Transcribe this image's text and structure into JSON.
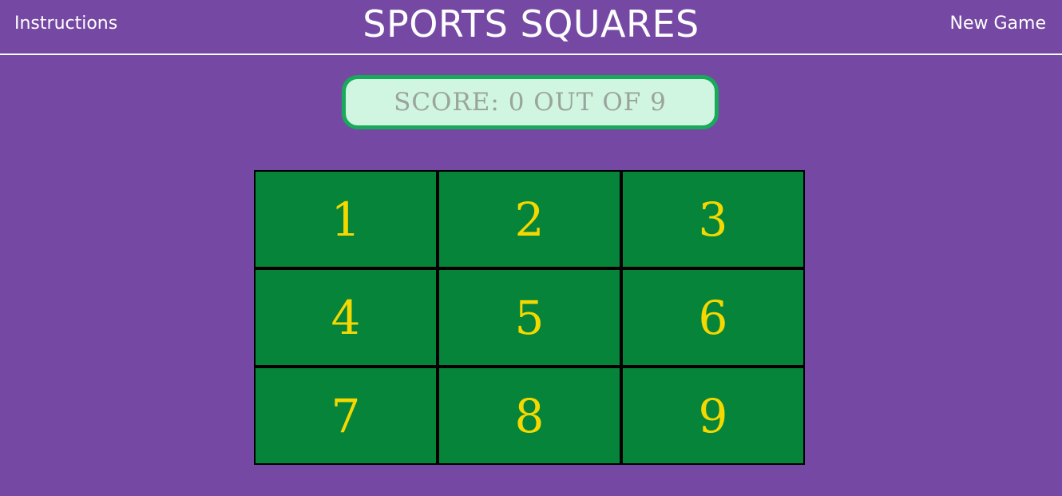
{
  "header": {
    "instructions_label": "Instructions",
    "title": "SPORTS SQUARES",
    "new_game_label": "New Game"
  },
  "score": {
    "text": "SCORE: 0 OUT OF 9",
    "value": 0,
    "total": 9
  },
  "board": {
    "squares": [
      "1",
      "2",
      "3",
      "4",
      "5",
      "6",
      "7",
      "8",
      "9"
    ]
  },
  "colors": {
    "background": "#7549a3",
    "square": "#06843a",
    "square_text": "#f5d800",
    "score_fill": "#d0f5e0",
    "score_border": "#18a95a",
    "score_text": "#9aa39c"
  }
}
